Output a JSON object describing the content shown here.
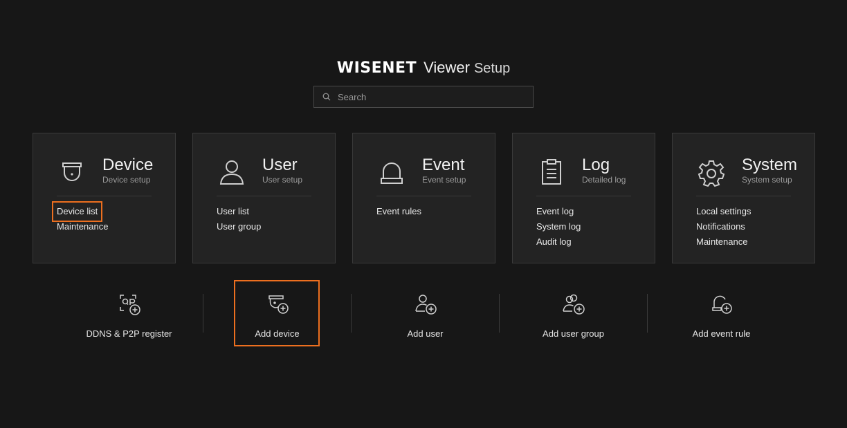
{
  "header": {
    "logo_text": "WISENET",
    "title_viewer": "Viewer",
    "title_setup": "Setup"
  },
  "search": {
    "placeholder": "Search",
    "icon": "search-icon"
  },
  "cards": [
    {
      "icon": "camera-icon",
      "title": "Device",
      "subtitle": "Device setup",
      "links": [
        "Device list",
        "Maintenance"
      ]
    },
    {
      "icon": "user-icon",
      "title": "User",
      "subtitle": "User setup",
      "links": [
        "User list",
        "User group"
      ]
    },
    {
      "icon": "bell-icon",
      "title": "Event",
      "subtitle": "Event setup",
      "links": [
        "Event rules"
      ]
    },
    {
      "icon": "clipboard-icon",
      "title": "Log",
      "subtitle": "Detailed log",
      "links": [
        "Event log",
        "System log",
        "Audit log"
      ]
    },
    {
      "icon": "gear-icon",
      "title": "System",
      "subtitle": "System setup",
      "links": [
        "Local settings",
        "Notifications",
        "Maintenance"
      ]
    }
  ],
  "actions": [
    {
      "icon": "qr-add-icon",
      "label": "DDNS & P2P register"
    },
    {
      "icon": "camera-add-icon",
      "label": "Add device"
    },
    {
      "icon": "user-add-icon",
      "label": "Add user"
    },
    {
      "icon": "user-group-add-icon",
      "label": "Add user group"
    },
    {
      "icon": "bell-add-icon",
      "label": "Add event rule"
    }
  ],
  "colors": {
    "background": "#171717",
    "card_background": "#232323",
    "highlight": "#ed6f1f"
  }
}
